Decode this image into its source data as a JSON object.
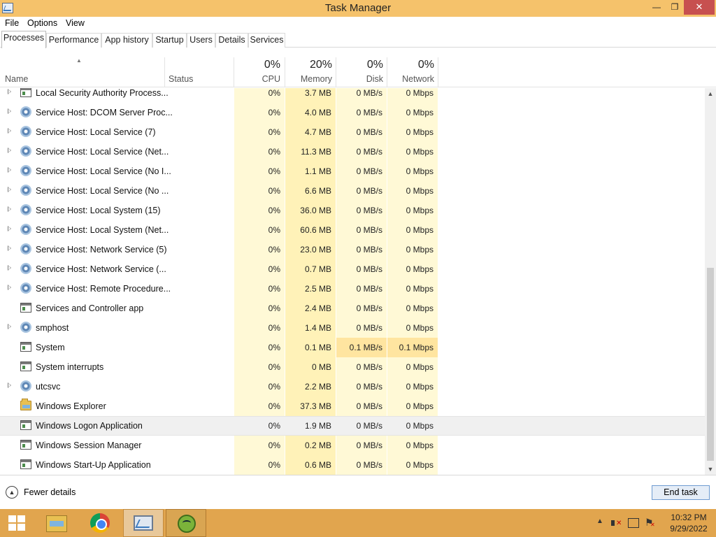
{
  "window": {
    "title": "Task Manager",
    "min_glyph": "—",
    "max_glyph": "❐",
    "close_glyph": "✕"
  },
  "menu": [
    "File",
    "Options",
    "View"
  ],
  "tabs": [
    "Processes",
    "Performance",
    "App history",
    "Startup",
    "Users",
    "Details",
    "Services"
  ],
  "active_tab": "Processes",
  "columns": {
    "name": "Name",
    "status": "Status",
    "cpu": {
      "pct": "0%",
      "label": "CPU"
    },
    "memory": {
      "pct": "20%",
      "label": "Memory"
    },
    "disk": {
      "pct": "0%",
      "label": "Disk"
    },
    "network": {
      "pct": "0%",
      "label": "Network"
    },
    "sort_glyph": "▲"
  },
  "colors": {
    "titlebar": "#f5c26b",
    "taskbar": "#e1a54e",
    "heat_light": "#fff9d6",
    "heat_medium": "#fff2b8",
    "heat_strong": "#ffe5a0"
  },
  "processes": [
    {
      "name": "Local Security Authority Process...",
      "icon": "window-icon",
      "expandable": true,
      "cpu": "0%",
      "memory": "3.7 MB",
      "disk": "0 MB/s",
      "network": "0 Mbps"
    },
    {
      "name": "Service Host: DCOM Server Proc...",
      "icon": "gear-icon",
      "expandable": true,
      "cpu": "0%",
      "memory": "4.0 MB",
      "disk": "0 MB/s",
      "network": "0 Mbps"
    },
    {
      "name": "Service Host: Local Service (7)",
      "icon": "gear-icon",
      "expandable": true,
      "cpu": "0%",
      "memory": "4.7 MB",
      "disk": "0 MB/s",
      "network": "0 Mbps"
    },
    {
      "name": "Service Host: Local Service (Net...",
      "icon": "gear-icon",
      "expandable": true,
      "cpu": "0%",
      "memory": "11.3 MB",
      "disk": "0 MB/s",
      "network": "0 Mbps"
    },
    {
      "name": "Service Host: Local Service (No I...",
      "icon": "gear-icon",
      "expandable": true,
      "cpu": "0%",
      "memory": "1.1 MB",
      "disk": "0 MB/s",
      "network": "0 Mbps"
    },
    {
      "name": "Service Host: Local Service (No ...",
      "icon": "gear-icon",
      "expandable": true,
      "cpu": "0%",
      "memory": "6.6 MB",
      "disk": "0 MB/s",
      "network": "0 Mbps"
    },
    {
      "name": "Service Host: Local System (15)",
      "icon": "gear-icon",
      "expandable": true,
      "cpu": "0%",
      "memory": "36.0 MB",
      "disk": "0 MB/s",
      "network": "0 Mbps"
    },
    {
      "name": "Service Host: Local System (Net...",
      "icon": "gear-icon",
      "expandable": true,
      "cpu": "0%",
      "memory": "60.6 MB",
      "disk": "0 MB/s",
      "network": "0 Mbps"
    },
    {
      "name": "Service Host: Network Service (5)",
      "icon": "gear-icon",
      "expandable": true,
      "cpu": "0%",
      "memory": "23.0 MB",
      "disk": "0 MB/s",
      "network": "0 Mbps"
    },
    {
      "name": "Service Host: Network Service (...",
      "icon": "gear-icon",
      "expandable": true,
      "cpu": "0%",
      "memory": "0.7 MB",
      "disk": "0 MB/s",
      "network": "0 Mbps"
    },
    {
      "name": "Service Host: Remote Procedure...",
      "icon": "gear-icon",
      "expandable": true,
      "cpu": "0%",
      "memory": "2.5 MB",
      "disk": "0 MB/s",
      "network": "0 Mbps"
    },
    {
      "name": "Services and Controller app",
      "icon": "window-icon",
      "expandable": false,
      "cpu": "0%",
      "memory": "2.4 MB",
      "disk": "0 MB/s",
      "network": "0 Mbps"
    },
    {
      "name": "smphost",
      "icon": "gear-icon",
      "expandable": true,
      "cpu": "0%",
      "memory": "1.4 MB",
      "disk": "0 MB/s",
      "network": "0 Mbps"
    },
    {
      "name": "System",
      "icon": "window-icon",
      "expandable": false,
      "cpu": "0%",
      "memory": "0.1 MB",
      "disk": "0.1 MB/s",
      "network": "0.1 Mbps",
      "highlight_io": true
    },
    {
      "name": "System interrupts",
      "icon": "window-icon",
      "expandable": false,
      "cpu": "0%",
      "memory": "0 MB",
      "disk": "0 MB/s",
      "network": "0 Mbps"
    },
    {
      "name": "utcsvc",
      "icon": "gear-icon",
      "expandable": true,
      "cpu": "0%",
      "memory": "2.2 MB",
      "disk": "0 MB/s",
      "network": "0 Mbps"
    },
    {
      "name": "Windows Explorer",
      "icon": "folder-icon",
      "expandable": false,
      "cpu": "0%",
      "memory": "37.3 MB",
      "disk": "0 MB/s",
      "network": "0 Mbps"
    },
    {
      "name": "Windows Logon Application",
      "icon": "window-icon",
      "expandable": false,
      "cpu": "0%",
      "memory": "1.9 MB",
      "disk": "0 MB/s",
      "network": "0 Mbps",
      "selected": true
    },
    {
      "name": "Windows Session Manager",
      "icon": "window-icon",
      "expandable": false,
      "cpu": "0%",
      "memory": "0.2 MB",
      "disk": "0 MB/s",
      "network": "0 Mbps"
    },
    {
      "name": "Windows Start-Up Application",
      "icon": "window-icon",
      "expandable": false,
      "cpu": "0%",
      "memory": "0.6 MB",
      "disk": "0 MB/s",
      "network": "0 Mbps"
    }
  ],
  "footer": {
    "fewer_details": "Fewer details",
    "fewer_glyph": "▲",
    "end_task": "End task"
  },
  "scrollbar": {
    "up_glyph": "▲",
    "down_glyph": "▼"
  },
  "taskbar": {
    "items": [
      "start-button",
      "file-explorer",
      "chrome",
      "task-manager",
      "frog-app"
    ],
    "tray_chevron": "▲",
    "time": "10:32 PM",
    "date": "9/29/2022"
  }
}
